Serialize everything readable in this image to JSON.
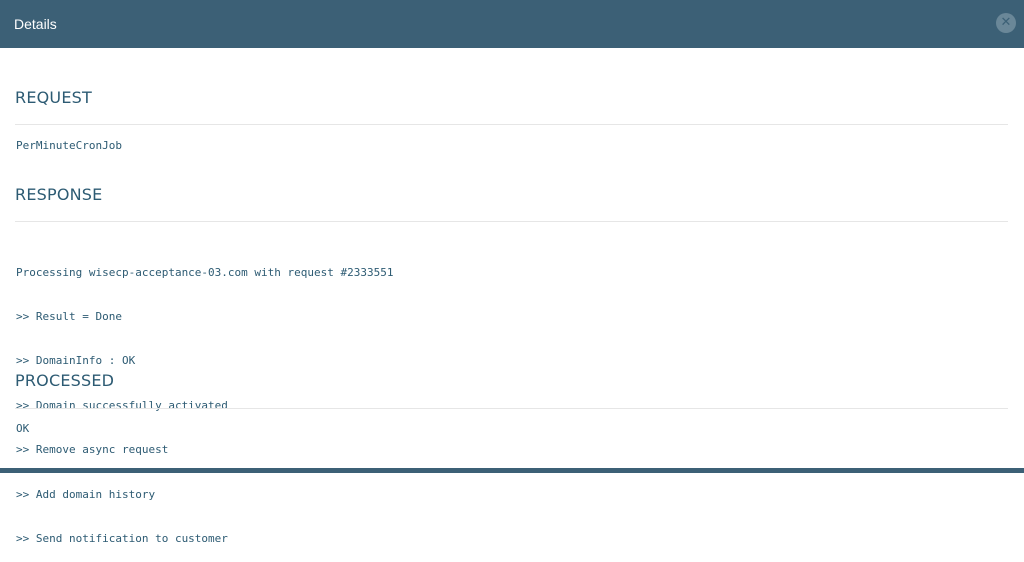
{
  "header": {
    "title": "Details",
    "close_icon_glyph": "✕"
  },
  "request": {
    "heading": "REQUEST",
    "body": "PerMinuteCronJob"
  },
  "response": {
    "heading": "RESPONSE",
    "lines": [
      "Processing wisecp-acceptance-03.com with request #2333551",
      ">> Result = Done",
      ">> DomainInfo : OK",
      ">> Domain successfully activated",
      ">> Remove async request",
      ">> Add domain history",
      ">> Send notification to customer"
    ]
  },
  "processed": {
    "heading": "PROCESSED",
    "body": "OK"
  },
  "colors": {
    "header_bg": "#3c6076",
    "text_accent": "#2d5b73",
    "divider": "#e6e6e6"
  }
}
